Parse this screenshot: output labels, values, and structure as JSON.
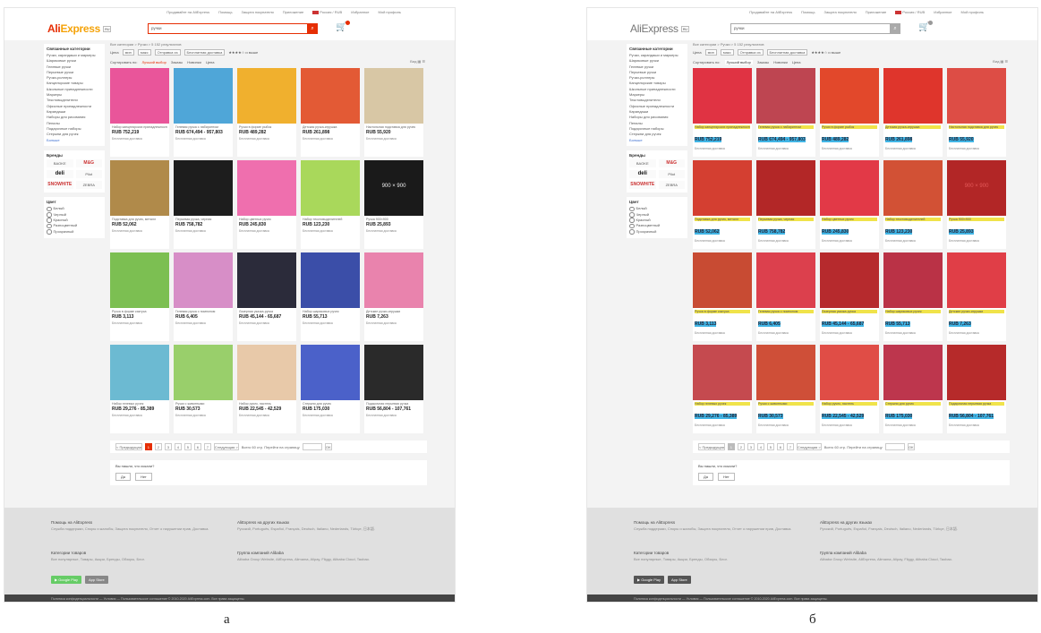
{
  "captions": {
    "left": "а",
    "right": "б"
  },
  "header": {
    "top_links": [
      "Продавайте на AliExpress",
      "Помощь",
      "Защита покупателя",
      "Приложение",
      "Россия / RUB",
      "Избранное",
      "Мой профиль"
    ],
    "logo_ali": "Ali",
    "logo_express": "Express",
    "logo_badge": "RU",
    "search_value": "ручки",
    "search_btn": "⌕",
    "cart_icon": "🛒"
  },
  "sidebar": {
    "categories_title": "Связанные категории",
    "categories": [
      "Ручки, карандаши и маркеры",
      "Шариковые ручки",
      "Гелевые ручки",
      "Перьевые ручки",
      "Ручки-роллеры",
      "Канцелярские товары",
      "Школьные принадлежности",
      "Маркеры",
      "Текстовыделители",
      "Офисные принадлежности",
      "Карандаши",
      "Наборы для рисования",
      "Пеналы",
      "Подарочные наборы",
      "Стержни для ручек"
    ],
    "more": "Больше",
    "brands_title": "Бренды",
    "brands": [
      "BAOKE",
      "M&G",
      "deli",
      "Pilot",
      "SNOWHITE",
      "ZEBRA"
    ],
    "color_title": "Цвет",
    "colors": [
      "Белый",
      "Черный",
      "Красный",
      "Разноцветный",
      "Прозрачный"
    ]
  },
  "main": {
    "breadcrumb": "Все категории > Ручки > 5 152 результатов",
    "filters": {
      "price_label": "Цена",
      "min": "мин",
      "max": "макс",
      "ship_from": "Отправка из",
      "free_ship": "Бесплатная доставка",
      "rating": "★★★★☆ и выше"
    },
    "sort": {
      "label": "Сортировать по:",
      "options": [
        "Лучший выбор",
        "Заказы",
        "Новинки",
        "Цена"
      ],
      "view": "Вид ▦ ☰"
    },
    "products": [
      {
        "title": "Набор канцелярских принадлежностей",
        "price": "RUB 752,219",
        "meta": "Бесплатная доставка",
        "color": "#e9559a",
        "label": ""
      },
      {
        "title": "Гелевая ручка с лабиринтом",
        "price": "RUB 674,494 - 957,803",
        "meta": "Бесплатная доставка",
        "color": "#4fa6d8",
        "label": ""
      },
      {
        "title": "Ручки в форме рыбок",
        "price": "RUB 489,282",
        "meta": "Бесплатная доставка",
        "color": "#f0b02e",
        "label": ""
      },
      {
        "title": "Детская ручка-игрушка",
        "price": "RUB 261,898",
        "meta": "Бесплатная доставка",
        "color": "#e35a35",
        "label": ""
      },
      {
        "title": "Настольная подставка для ручек",
        "price": "RUB 55,920",
        "meta": "Бесплатная доставка",
        "color": "#d8c7a5",
        "label": ""
      },
      {
        "title": "Подставка для ручек, металл",
        "price": "RUB 52,062",
        "meta": "Бесплатная доставка",
        "color": "#b08a4a",
        "label": ""
      },
      {
        "title": "Перьевая ручка, черная",
        "price": "RUB 758,782",
        "meta": "Бесплатная доставка",
        "color": "#1d1d1d",
        "label": ""
      },
      {
        "title": "Набор цветных ручек",
        "price": "RUB 245,830",
        "meta": "Бесплатная доставка",
        "color": "#ef6fae",
        "label": ""
      },
      {
        "title": "Набор текстовыделителей",
        "price": "RUB 123,230",
        "meta": "Бесплатная доставка",
        "color": "#a9d85b",
        "label": ""
      },
      {
        "title": "Ручка 900×900",
        "price": "RUB 25,893",
        "meta": "Бесплатная доставка",
        "color": "#1a1a1a",
        "label": "900 × 900"
      },
      {
        "title": "Ручка в форме кактуса",
        "price": "RUB 3,113",
        "meta": "Бесплатная доставка",
        "color": "#7cbf52",
        "label": ""
      },
      {
        "title": "Гелевая ручка с помпоном",
        "price": "RUB 6,405",
        "meta": "Бесплатная доставка",
        "color": "#d78ec7",
        "label": ""
      },
      {
        "title": "Лазерная указка-ручка",
        "price": "RUB 45,144 - 65,687",
        "meta": "Бесплатная доставка",
        "color": "#2b2b3a",
        "label": ""
      },
      {
        "title": "Набор шариковых ручек",
        "price": "RUB 55,713",
        "meta": "Бесплатная доставка",
        "color": "#3b4ea8",
        "label": ""
      },
      {
        "title": "Детские ручки-игрушки",
        "price": "RUB 7,263",
        "meta": "Бесплатная доставка",
        "color": "#e983ad",
        "label": ""
      },
      {
        "title": "Набор гелевых ручек",
        "price": "RUB 29,276 - 85,389",
        "meta": "Бесплатная доставка",
        "color": "#6cbad2",
        "label": ""
      },
      {
        "title": "Ручки с животными",
        "price": "RUB 30,573",
        "meta": "Бесплатная доставка",
        "color": "#99cf6b",
        "label": ""
      },
      {
        "title": "Набор ручек, пастель",
        "price": "RUB 22,545 - 42,529",
        "meta": "Бесплатная доставка",
        "color": "#e8c9a9",
        "label": ""
      },
      {
        "title": "Стержни для ручек",
        "price": "RUB 175,030",
        "meta": "Бесплатная доставка",
        "color": "#4b61c9",
        "label": ""
      },
      {
        "title": "Подарочная перьевая ручка",
        "price": "RUB 56,804 - 107,761",
        "meta": "Бесплатная доставка",
        "color": "#2a2a2a",
        "label": ""
      }
    ],
    "pager": {
      "prev": "< Предыдущая",
      "pages": [
        "1",
        "2",
        "3",
        "4",
        "5",
        "6",
        "7"
      ],
      "next": "Следующая >",
      "goto": "Всего 60 стр. Перейти на страницу",
      "go": "OK"
    },
    "feedback": {
      "question": "Вы нашли, что искали?",
      "yes": "Да",
      "no": "Нет"
    }
  },
  "footer": {
    "col1_title": "Помощь на AliExpress",
    "col1_text": "Служба поддержки, Споры и жалобы, Защита покупателя, Отчет о нарушении прав, Доставка.",
    "col2_title": "AliExpress на других языках",
    "col2_text": "Русский, Português, Español, Français, Deutsch, Italiano, Nederlands, Türkçe, 日本語.",
    "col3_title": "Категории товаров",
    "col3_text": "Все популярные, Товары, Акции, Бренды, Обзоры, Блог.",
    "col4_title": "Группа компаний Alibaba",
    "col4_text": "Alibaba Group Website, AliExpress, Alimama, Alipay, Fliggy, Alibaba Cloud, Taobao.",
    "google_play": "▶ Google Play",
    "app_store": " App Store",
    "bottom": "Политика конфиденциальности — Условия — Пользовательское соглашение © 2010-2020 AliExpress.com. Все права защищены."
  }
}
